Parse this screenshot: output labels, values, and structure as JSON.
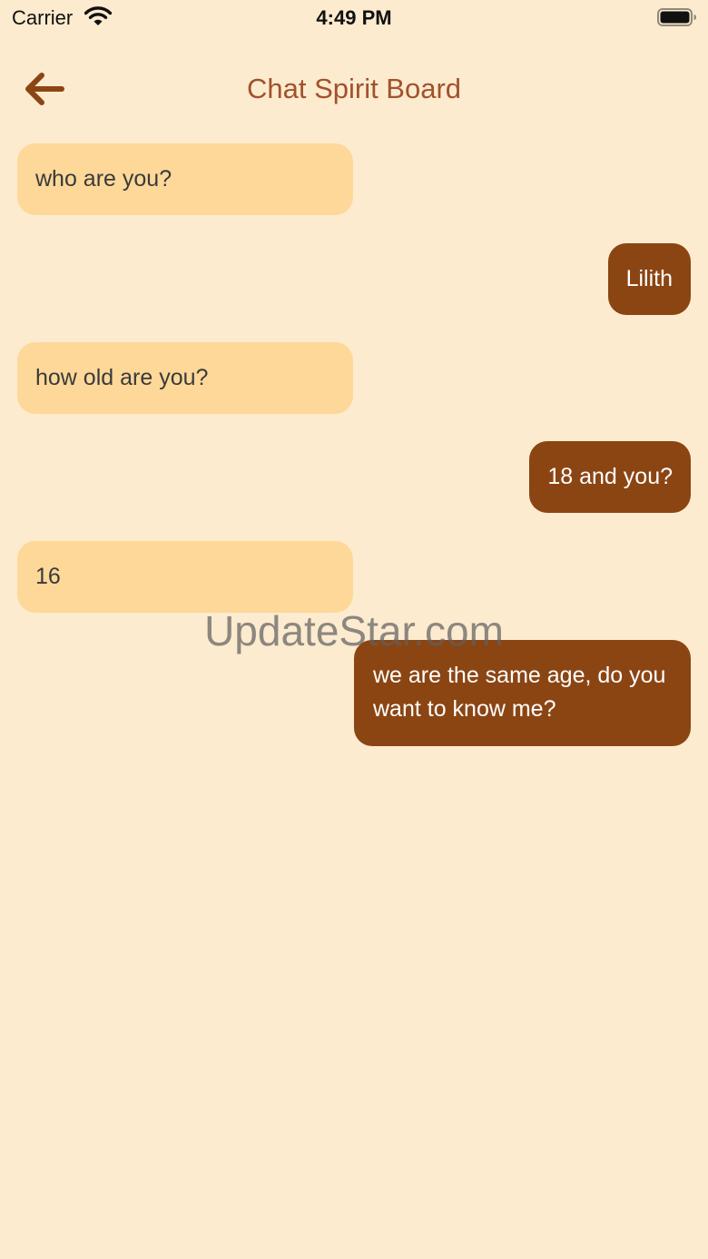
{
  "status_bar": {
    "carrier": "Carrier",
    "time": "4:49 PM",
    "wifi_icon": "wifi-icon",
    "battery_icon": "battery-icon"
  },
  "header": {
    "title": "Chat Spirit Board",
    "back_icon": "arrow-left-icon"
  },
  "messages": [
    {
      "sender": "incoming",
      "text": "who are you?"
    },
    {
      "sender": "outgoing",
      "text": "Lilith"
    },
    {
      "sender": "incoming",
      "text": "how old are you?"
    },
    {
      "sender": "outgoing",
      "text": "18 and you?"
    },
    {
      "sender": "incoming",
      "text": "16"
    },
    {
      "sender": "outgoing",
      "text": "we are the same age, do you want to know me?"
    }
  ],
  "watermark": "UpdateStar.com",
  "colors": {
    "background": "#FDEBCF",
    "incoming_bubble": "#FDD899",
    "outgoing_bubble": "#8B4513",
    "accent": "#8B4513",
    "title": "#A0522D"
  }
}
